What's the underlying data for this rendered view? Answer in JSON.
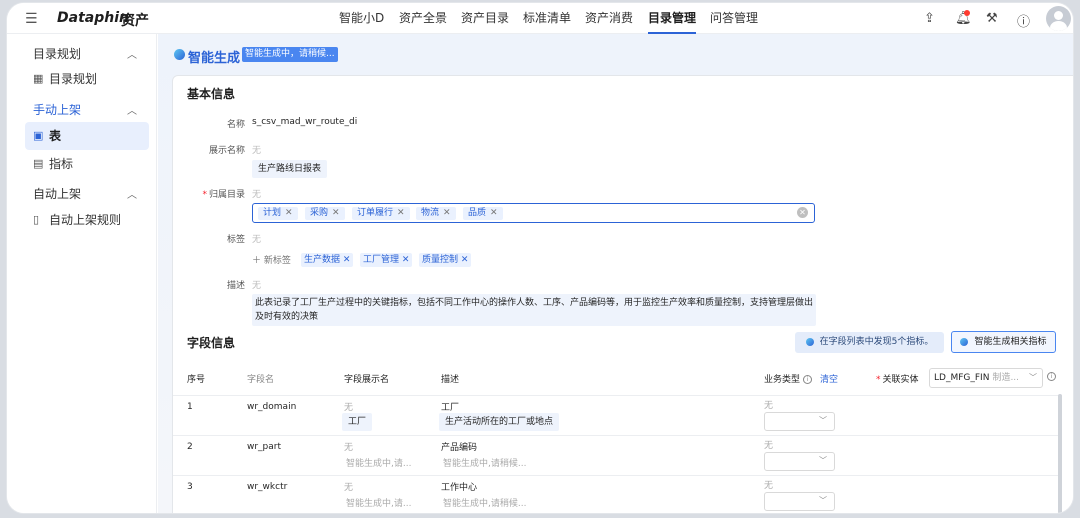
{
  "header": {
    "logo": "Dataphin",
    "product": "资产",
    "nav": [
      "智能小D",
      "资产全景",
      "资产目录",
      "标准清单",
      "资产消费",
      "目录管理",
      "问答管理"
    ],
    "active_nav": "目录管理"
  },
  "sidebar": {
    "groups": [
      {
        "label": "目录规划",
        "items": [
          "目录规划"
        ]
      },
      {
        "label": "手动上架",
        "items": [
          "表",
          "指标"
        ]
      },
      {
        "label": "自动上架",
        "items": [
          "自动上架规则"
        ]
      }
    ],
    "active_item": "表"
  },
  "banner": {
    "title": "智能生成",
    "status": "智能生成中，请稍候..."
  },
  "basic": {
    "section_title": "基本信息",
    "name_label": "名称",
    "name_value": "s_csv_mad_wr_route_di",
    "display_label": "展示名称",
    "display_original": "无",
    "display_ai": "生产路线日报表",
    "catalog_label": "归属目录",
    "catalog_original": "无",
    "catalog_tags": [
      "计划",
      "采购",
      "订单履行",
      "物流",
      "品质"
    ],
    "tag_label": "标签",
    "tag_original": "无",
    "new_tag": "新标签",
    "labels": [
      "生产数据",
      "工厂管理",
      "质量控制"
    ],
    "desc_label": "描述",
    "desc_original": "无",
    "desc_ai": "此表记录了工厂生产过程中的关键指标，包括不同工作中心的操作人数、工序、产品编码等，用于监控生产效率和质量控制，支持管理层做出及时有效的决策"
  },
  "fields": {
    "section_title": "字段信息",
    "hint": "在字段列表中发现5个指标。",
    "gen_button": "智能生成相关指标",
    "columns": {
      "index": "序号",
      "name": "字段名",
      "display": "字段展示名",
      "desc": "描述",
      "biz_type": "业务类型",
      "clear": "清空",
      "entity": "关联实体"
    },
    "entity_value": "LD_MFG_FIN",
    "entity_placeholder": "制造...",
    "rows": [
      {
        "index": "1",
        "name": "wr_domain",
        "display_orig": "无",
        "display_ai": "工厂",
        "desc_orig": "工厂",
        "desc_ai": "生产活动所在的工厂或地点",
        "biz_orig": "无"
      },
      {
        "index": "2",
        "name": "wr_part",
        "display_orig": "无",
        "display_ai": "智能生成中,请...",
        "desc_orig": "产品编码",
        "desc_ai": "智能生成中,请稍候...",
        "biz_orig": "无"
      },
      {
        "index": "3",
        "name": "wr_wkctr",
        "display_orig": "无",
        "display_ai": "智能生成中,请...",
        "desc_orig": "工作中心",
        "desc_ai": "智能生成中,请稍候...",
        "biz_orig": "无"
      }
    ]
  }
}
